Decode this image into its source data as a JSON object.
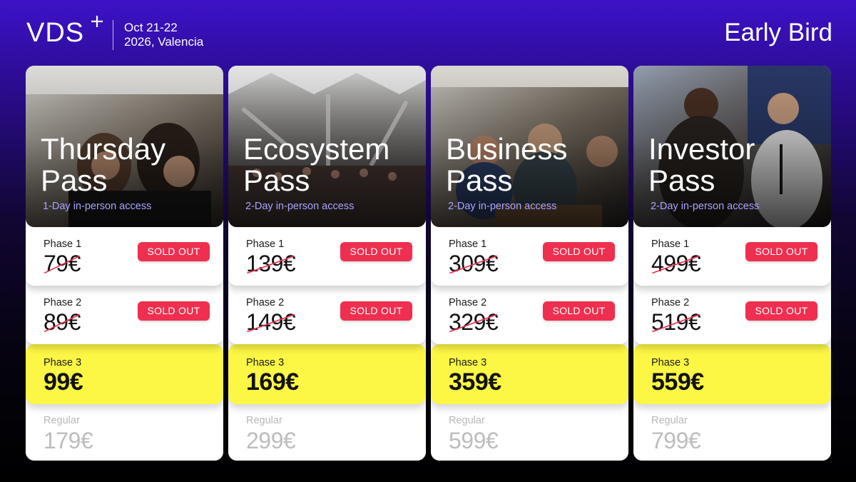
{
  "header": {
    "logo": "VDS",
    "event_date": "Oct 21-22",
    "event_place": "2026, Valencia",
    "edition": "Early Bird"
  },
  "colors": {
    "background_top": "#3d12c8",
    "background_bottom": "#000000",
    "sold_out_badge": "#ef2f4f",
    "active_phase": "#fcf645",
    "subtitle": "#a9a4ff"
  },
  "passes": [
    {
      "title_line1": "Thursday",
      "title_line2": "Pass",
      "subtitle": "1-Day in-person access",
      "phases": [
        {
          "label": "Phase 1",
          "price": "79€",
          "status": "SOLD OUT"
        },
        {
          "label": "Phase 2",
          "price": "89€",
          "status": "SOLD OUT"
        },
        {
          "label": "Phase 3",
          "price": "99€"
        },
        {
          "label": "Regular",
          "price": "179€"
        }
      ]
    },
    {
      "title_line1": "Ecosystem",
      "title_line2": "Pass",
      "subtitle": "2-Day in-person access",
      "phases": [
        {
          "label": "Phase 1",
          "price": "139€",
          "status": "SOLD OUT"
        },
        {
          "label": "Phase 2",
          "price": "149€",
          "status": "SOLD OUT"
        },
        {
          "label": "Phase 3",
          "price": "169€"
        },
        {
          "label": "Regular",
          "price": "299€"
        }
      ]
    },
    {
      "title_line1": "Business",
      "title_line2": "Pass",
      "subtitle": "2-Day in-person access",
      "phases": [
        {
          "label": "Phase 1",
          "price": "309€",
          "status": "SOLD OUT"
        },
        {
          "label": "Phase 2",
          "price": "329€",
          "status": "SOLD OUT"
        },
        {
          "label": "Phase 3",
          "price": "359€"
        },
        {
          "label": "Regular",
          "price": "599€"
        }
      ]
    },
    {
      "title_line1": "Investor",
      "title_line2": "Pass",
      "subtitle": "2-Day in-person access",
      "phases": [
        {
          "label": "Phase 1",
          "price": "499€",
          "status": "SOLD OUT"
        },
        {
          "label": "Phase 2",
          "price": "519€",
          "status": "SOLD OUT"
        },
        {
          "label": "Phase 3",
          "price": "559€"
        },
        {
          "label": "Regular",
          "price": "799€"
        }
      ]
    }
  ]
}
